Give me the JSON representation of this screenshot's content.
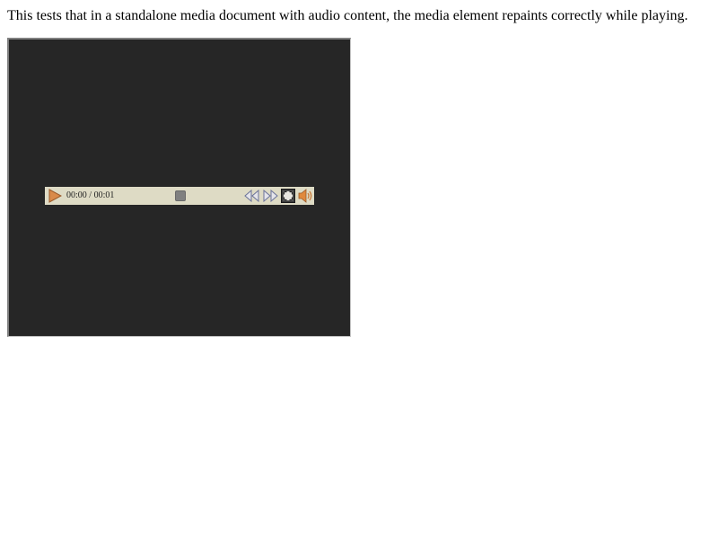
{
  "page": {
    "description": "This tests that in a standalone media document with audio content, the media element repaints correctly while playing."
  },
  "media": {
    "current_time": "00:00",
    "separator": " / ",
    "duration": "00:01",
    "time_display": "00:00 / 00:01",
    "playback_progress": 0.0
  },
  "icons": {
    "play": "play-icon",
    "timeline_thumb": "timeline-thumb",
    "rewind": "rewind-icon",
    "fast_forward": "fast-forward-icon",
    "fullscreen": "fullscreen-icon",
    "volume": "volume-icon"
  },
  "colors": {
    "page_background": "#ffffff",
    "media_background": "#262626",
    "controls_background": "#dedbc5",
    "play_accent": "#c87a3a",
    "seek_icon": "#707aa0",
    "thumb": "#808080"
  }
}
